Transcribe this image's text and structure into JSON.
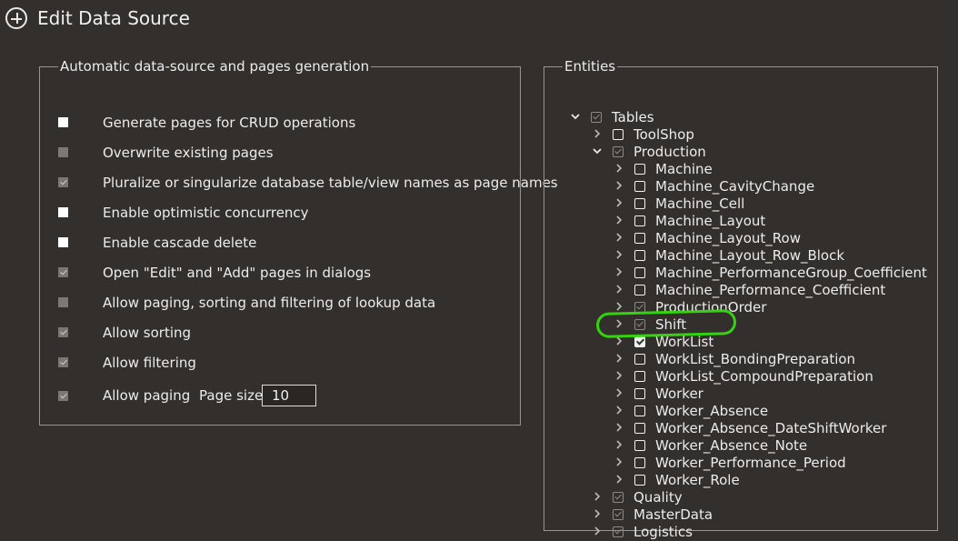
{
  "header": {
    "title": "Edit Data Source",
    "icon": "plus-circle-icon"
  },
  "left_panel": {
    "legend": "Automatic data-source and pages generation",
    "options": [
      {
        "label": "Generate pages for CRUD operations",
        "state": "white"
      },
      {
        "label": "Overwrite existing pages",
        "state": "gray"
      },
      {
        "label": "Pluralize or singularize database table/view names as page names",
        "state": "graycheck"
      },
      {
        "label": "Enable optimistic concurrency",
        "state": "white"
      },
      {
        "label": "Enable cascade delete",
        "state": "white"
      },
      {
        "label": "Open \"Edit\" and \"Add\" pages in dialogs",
        "state": "graycheck"
      },
      {
        "label": "Allow paging, sorting and filtering of lookup data",
        "state": "gray"
      },
      {
        "label": "Allow sorting",
        "state": "graycheck"
      },
      {
        "label": "Allow filtering",
        "state": "graycheck"
      },
      {
        "label": "Allow paging",
        "state": "graycheck"
      }
    ],
    "page_size_label": "Page size",
    "page_size_value": "10"
  },
  "right_panel": {
    "legend": "Entities",
    "tree": [
      {
        "label": "Tables",
        "level": 0,
        "expanded": true,
        "check": "tri"
      },
      {
        "label": "ToolShop",
        "level": 1,
        "expanded": false,
        "check": "empty"
      },
      {
        "label": "Production",
        "level": 1,
        "expanded": true,
        "check": "tri"
      },
      {
        "label": "Machine",
        "level": 2,
        "expanded": false,
        "check": "empty"
      },
      {
        "label": "Machine_CavityChange",
        "level": 2,
        "expanded": false,
        "check": "empty"
      },
      {
        "label": "Machine_Cell",
        "level": 2,
        "expanded": false,
        "check": "empty"
      },
      {
        "label": "Machine_Layout",
        "level": 2,
        "expanded": false,
        "check": "empty"
      },
      {
        "label": "Machine_Layout_Row",
        "level": 2,
        "expanded": false,
        "check": "empty"
      },
      {
        "label": "Machine_Layout_Row_Block",
        "level": 2,
        "expanded": false,
        "check": "empty"
      },
      {
        "label": "Machine_PerformanceGroup_Coefficient",
        "level": 2,
        "expanded": false,
        "check": "empty"
      },
      {
        "label": "Machine_Performance_Coefficient",
        "level": 2,
        "expanded": false,
        "check": "empty"
      },
      {
        "label": "ProductionOrder",
        "level": 2,
        "expanded": false,
        "check": "tri"
      },
      {
        "label": "Shift",
        "level": 2,
        "expanded": false,
        "check": "tri"
      },
      {
        "label": "WorkList",
        "level": 2,
        "expanded": false,
        "check": "checked"
      },
      {
        "label": "WorkList_BondingPreparation",
        "level": 2,
        "expanded": false,
        "check": "empty"
      },
      {
        "label": "WorkList_CompoundPreparation",
        "level": 2,
        "expanded": false,
        "check": "empty"
      },
      {
        "label": "Worker",
        "level": 2,
        "expanded": false,
        "check": "empty"
      },
      {
        "label": "Worker_Absence",
        "level": 2,
        "expanded": false,
        "check": "empty"
      },
      {
        "label": "Worker_Absence_DateShiftWorker",
        "level": 2,
        "expanded": false,
        "check": "empty"
      },
      {
        "label": "Worker_Absence_Note",
        "level": 2,
        "expanded": false,
        "check": "empty"
      },
      {
        "label": "Worker_Performance_Period",
        "level": 2,
        "expanded": false,
        "check": "empty"
      },
      {
        "label": "Worker_Role",
        "level": 2,
        "expanded": false,
        "check": "empty"
      },
      {
        "label": "Quality",
        "level": 1,
        "expanded": false,
        "check": "tri"
      },
      {
        "label": "MasterData",
        "level": 1,
        "expanded": false,
        "check": "tri"
      },
      {
        "label": "Logistics",
        "level": 1,
        "expanded": false,
        "check": "tri"
      }
    ]
  },
  "colors": {
    "background": "#332f2c",
    "highlight": "#33d30f",
    "text": "#ececec"
  }
}
